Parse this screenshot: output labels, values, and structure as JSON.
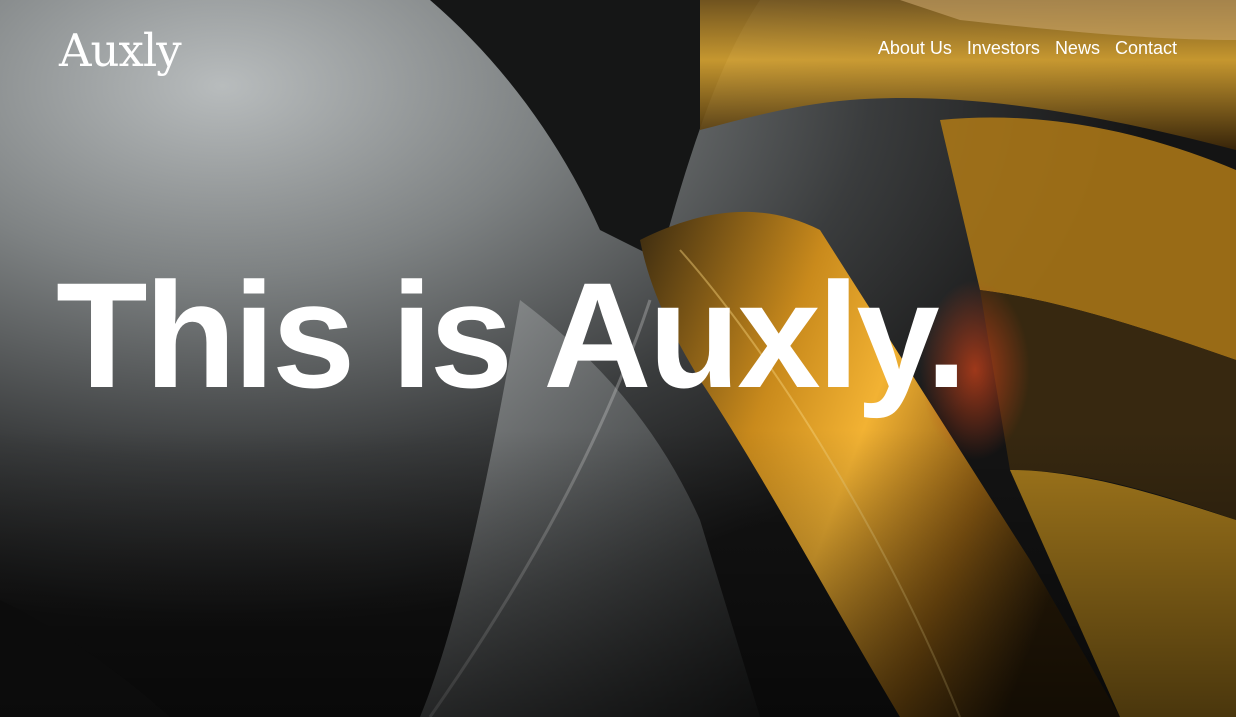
{
  "header": {
    "logo_text": "Auxly",
    "nav": [
      {
        "label": "About Us"
      },
      {
        "label": "Investors"
      },
      {
        "label": "News"
      },
      {
        "label": "Contact"
      }
    ]
  },
  "hero": {
    "headline": "This is Auxly."
  },
  "colors": {
    "text": "#ffffff",
    "background": "#111111",
    "accent_gold": "#e0a020"
  }
}
